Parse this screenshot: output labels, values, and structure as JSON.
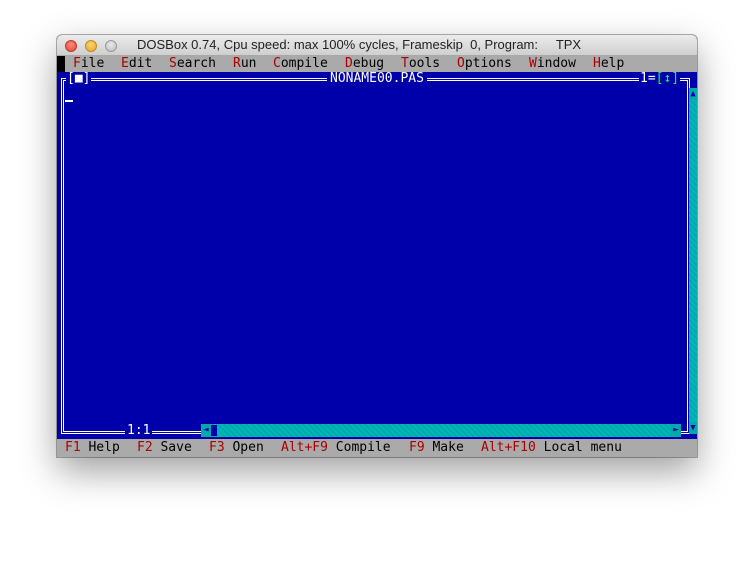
{
  "window": {
    "title": "DOSBox 0.74, Cpu speed: max 100% cycles, Frameskip  0, Program:     TPX"
  },
  "menu": {
    "items": [
      {
        "hot": "F",
        "rest": "ile"
      },
      {
        "hot": "E",
        "rest": "dit"
      },
      {
        "hot": "S",
        "rest": "earch"
      },
      {
        "hot": "R",
        "rest": "un"
      },
      {
        "hot": "C",
        "rest": "ompile"
      },
      {
        "hot": "D",
        "rest": "ebug"
      },
      {
        "hot": "T",
        "rest": "ools"
      },
      {
        "hot": "O",
        "rest": "ptions"
      },
      {
        "hot": "W",
        "rest": "indow"
      },
      {
        "hot": "H",
        "rest": "elp"
      }
    ]
  },
  "editor": {
    "close_box": "[■]",
    "filename": "NONAME00.PAS",
    "window_number": "1",
    "zoom_box": "[↕]",
    "cursor_position": "1:1"
  },
  "status": {
    "items": [
      {
        "key": "F1",
        "label": "Help"
      },
      {
        "key": "F2",
        "label": "Save"
      },
      {
        "key": "F3",
        "label": "Open"
      },
      {
        "key": "Alt+F9",
        "label": "Compile"
      },
      {
        "key": "F9",
        "label": "Make"
      },
      {
        "key": "Alt+F10",
        "label": "Local menu"
      }
    ]
  },
  "colors": {
    "desktop_blue": "#0000aa",
    "menu_gray": "#aaaaaa",
    "hotkey_red": "#aa0000",
    "scrollbar_cyan": "#00aaaa"
  }
}
